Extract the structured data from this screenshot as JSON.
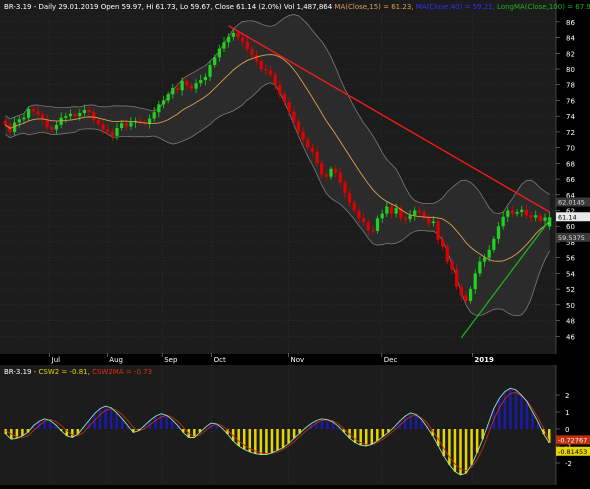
{
  "header": {
    "symbol": "BR-3.19",
    "info": " - Daily 29.01.2019 Open 59.97, Hi 61.73, Lo 59.67, Close 61.14 (2.0%) Vol 1,487,864",
    "ma_label": "MA(Close,15) = 61.23,",
    "ma_label2": "MA(Close,40) = 59.21,",
    "long_label": "LongMA(Close,100) = 67.90,",
    "bb_label": "BB"
  },
  "subheader": {
    "symbol": "BR-3.19",
    "csw2": "- CSW2 = -0.81,",
    "csw2ma": "CSW2MA = -0.73"
  },
  "colors": {
    "background": "#000000",
    "plot_bg": "#1c1c1c",
    "grid": "#3a3a3a",
    "up_candle": "#1fd21f",
    "down_candle": "#e00000",
    "ma15": "#d9a050",
    "bands": "#7a7a7a",
    "trend_down": "#ff1a1a",
    "trend_up": "#1db21d",
    "hist_pos": "#1a1ab0",
    "hist_neg": "#e6d600",
    "csw_line": "#9ee29e",
    "csw_ma": "#c03010"
  },
  "chart_data": [
    {
      "type": "candlestick",
      "ylim": [
        44,
        87
      ],
      "y_ticks": [
        46,
        48,
        50,
        52,
        54,
        56,
        58,
        60,
        62,
        64,
        66,
        68,
        70,
        72,
        74,
        76,
        78,
        80,
        82,
        84,
        86
      ],
      "x_ticks": [
        "Jul",
        "Aug",
        "Sep",
        "Oct",
        "Nov",
        "Dec",
        "2019"
      ],
      "price_tags": {
        "upper_band": "62.0145",
        "last": "61.14",
        "lower_band": "59.5375"
      },
      "close": [
        72.9,
        72.0,
        73.2,
        73.6,
        73.8,
        74.9,
        74.6,
        74.2,
        73.6,
        72.6,
        72.3,
        72.9,
        73.8,
        74.0,
        74.3,
        74.0,
        74.4,
        74.8,
        74.5,
        73.5,
        73.0,
        72.3,
        72.0,
        71.5,
        72.5,
        73.1,
        72.7,
        73.2,
        73.4,
        73.2,
        73.0,
        73.7,
        74.5,
        75.5,
        76.0,
        76.8,
        77.6,
        77.3,
        78.5,
        77.9,
        77.5,
        78.2,
        78.6,
        79.0,
        80.5,
        81.5,
        82.6,
        83.4,
        84.1,
        84.6,
        84.0,
        83.5,
        82.5,
        81.8,
        81.0,
        80.0,
        79.8,
        79.3,
        78.0,
        76.8,
        75.8,
        74.6,
        73.3,
        72.0,
        71.0,
        70.0,
        69.5,
        68.0,
        66.6,
        66.3,
        67.3,
        66.8,
        65.6,
        64.2,
        63.0,
        62.0,
        61.0,
        60.5,
        59.5,
        59.4,
        61.0,
        61.6,
        62.5,
        61.6,
        62.3,
        61.0,
        60.9,
        61.4,
        62.0,
        61.8,
        61.1,
        60.4,
        60.6,
        58.3,
        57.4,
        55.5,
        54.5,
        52.3,
        51.2,
        50.5,
        52.0,
        54.0,
        55.5,
        56.0,
        57.0,
        58.4,
        60.0,
        61.2,
        62.0,
        61.6,
        61.8,
        62.1,
        61.4,
        61.1,
        61.4,
        60.7,
        61.1,
        61.14
      ],
      "open": [
        73.4,
        72.9,
        72.0,
        73.2,
        73.6,
        73.8,
        74.9,
        74.6,
        74.2,
        73.6,
        72.6,
        72.3,
        72.9,
        73.8,
        74.0,
        74.3,
        74.0,
        74.4,
        74.8,
        74.5,
        73.5,
        73.0,
        72.3,
        72.0,
        71.5,
        72.5,
        73.1,
        72.7,
        73.2,
        73.4,
        73.2,
        73.0,
        73.7,
        74.5,
        75.5,
        76.0,
        76.8,
        77.6,
        77.3,
        78.5,
        77.9,
        77.5,
        78.2,
        78.6,
        79.0,
        80.5,
        81.5,
        82.6,
        83.4,
        84.1,
        84.6,
        84.0,
        83.5,
        82.5,
        81.8,
        81.0,
        80.0,
        79.8,
        79.3,
        78.0,
        76.8,
        75.8,
        74.6,
        73.3,
        72.0,
        71.0,
        70.0,
        69.5,
        68.0,
        66.6,
        66.3,
        67.3,
        66.8,
        65.6,
        64.2,
        63.0,
        62.0,
        61.0,
        60.5,
        59.5,
        59.4,
        61.0,
        61.6,
        62.5,
        61.6,
        62.3,
        61.0,
        60.9,
        61.4,
        62.0,
        61.8,
        61.1,
        60.4,
        60.6,
        58.3,
        57.4,
        55.5,
        54.5,
        52.3,
        51.2,
        50.5,
        52.0,
        54.0,
        55.5,
        56.0,
        57.0,
        58.4,
        60.0,
        61.2,
        62.0,
        61.6,
        61.8,
        62.1,
        61.4,
        61.1,
        61.4,
        60.7,
        59.97
      ]
    },
    {
      "type": "bar",
      "ylim": [
        -3,
        3
      ],
      "y_ticks": [
        -2,
        -1,
        0,
        1,
        2
      ],
      "value_tags": {
        "csw2ma": "-0.72767",
        "csw2": "-0.81453"
      },
      "series": [
        {
          "name": "CSW2",
          "values": [
            -0.3,
            -0.6,
            -0.55,
            -0.4,
            -0.2,
            0.2,
            0.45,
            0.6,
            0.5,
            0.25,
            -0.1,
            -0.4,
            -0.5,
            -0.3,
            0.1,
            0.5,
            0.9,
            1.2,
            1.35,
            1.25,
            0.95,
            0.6,
            0.2,
            -0.2,
            -0.1,
            0.2,
            0.5,
            0.75,
            0.9,
            0.8,
            0.55,
            0.2,
            -0.2,
            -0.5,
            -0.5,
            -0.2,
            0.1,
            0.35,
            0.3,
            0.05,
            -0.3,
            -0.7,
            -1.0,
            -1.2,
            -1.35,
            -1.45,
            -1.5,
            -1.5,
            -1.4,
            -1.25,
            -1.1,
            -0.85,
            -0.55,
            -0.25,
            0.05,
            0.3,
            0.5,
            0.6,
            0.55,
            0.4,
            0.15,
            -0.2,
            -0.55,
            -0.8,
            -0.95,
            -1.0,
            -0.9,
            -0.7,
            -0.45,
            -0.2,
            0.1,
            0.45,
            0.75,
            0.95,
            0.85,
            0.55,
            0.1,
            -0.4,
            -1.0,
            -1.6,
            -2.1,
            -2.5,
            -2.7,
            -2.6,
            -2.1,
            -1.4,
            -0.6,
            0.3,
            1.2,
            1.8,
            2.2,
            2.4,
            2.3,
            2.0,
            1.6,
            1.0,
            0.4,
            -0.3,
            -0.81
          ]
        },
        {
          "name": "CSW2MA",
          "values": [
            -0.1,
            -0.3,
            -0.45,
            -0.5,
            -0.4,
            -0.1,
            0.2,
            0.45,
            0.55,
            0.45,
            0.2,
            -0.1,
            -0.35,
            -0.4,
            -0.2,
            0.15,
            0.5,
            0.85,
            1.1,
            1.2,
            1.1,
            0.85,
            0.5,
            0.1,
            -0.1,
            0.0,
            0.25,
            0.5,
            0.7,
            0.8,
            0.7,
            0.45,
            0.1,
            -0.25,
            -0.45,
            -0.35,
            -0.1,
            0.15,
            0.3,
            0.2,
            -0.05,
            -0.4,
            -0.7,
            -0.95,
            -1.15,
            -1.3,
            -1.4,
            -1.45,
            -1.42,
            -1.35,
            -1.2,
            -1.0,
            -0.75,
            -0.45,
            -0.15,
            0.1,
            0.35,
            0.5,
            0.55,
            0.48,
            0.3,
            0.0,
            -0.3,
            -0.6,
            -0.8,
            -0.92,
            -0.92,
            -0.8,
            -0.6,
            -0.35,
            -0.1,
            0.2,
            0.5,
            0.75,
            0.8,
            0.65,
            0.35,
            -0.1,
            -0.6,
            -1.15,
            -1.65,
            -2.05,
            -2.35,
            -2.45,
            -2.25,
            -1.8,
            -1.15,
            -0.3,
            0.55,
            1.25,
            1.75,
            2.1,
            2.15,
            1.95,
            1.65,
            1.2,
            0.65,
            0.05,
            -0.73
          ]
        }
      ]
    }
  ]
}
